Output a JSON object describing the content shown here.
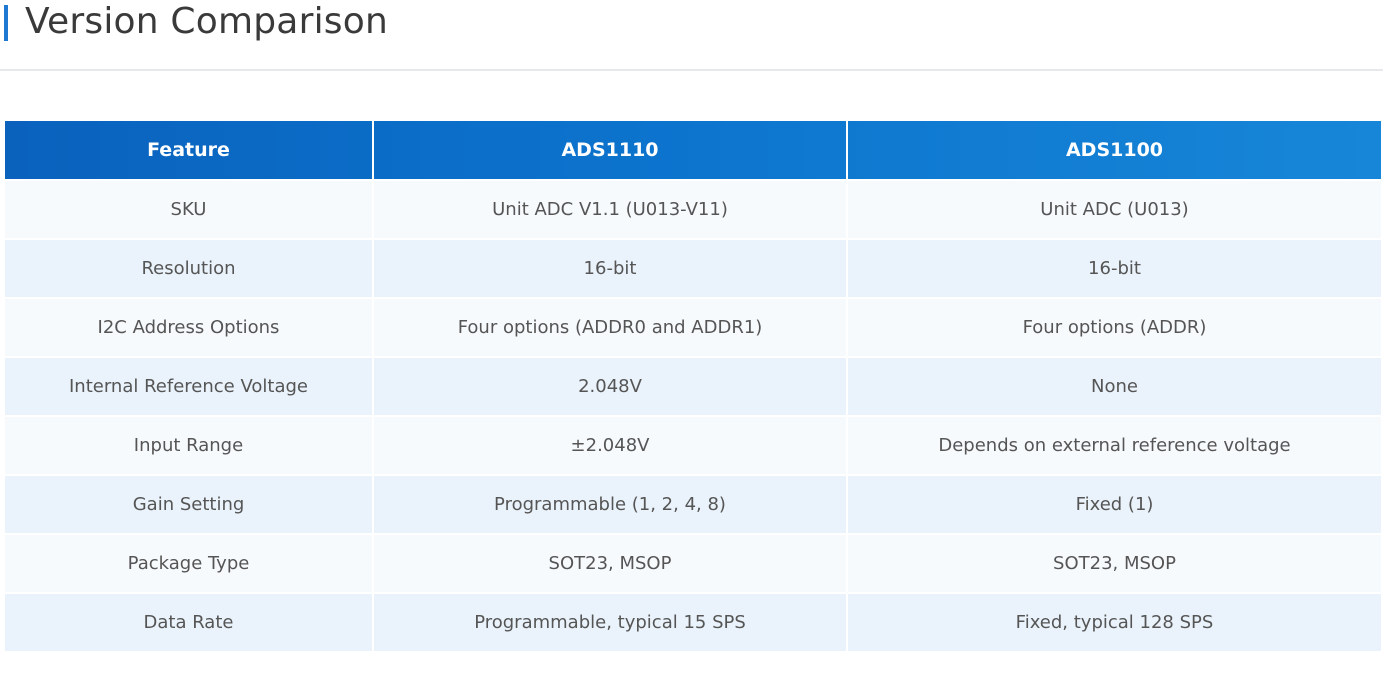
{
  "page": {
    "title": "Version Comparison"
  },
  "table": {
    "headers": [
      "Feature",
      "ADS1110",
      "ADS1100"
    ],
    "rows": [
      [
        "SKU",
        "Unit ADC V1.1 (U013-V11)",
        "Unit ADC (U013)"
      ],
      [
        "Resolution",
        "16-bit",
        "16-bit"
      ],
      [
        "I2C Address Options",
        "Four options (ADDR0 and ADDR1)",
        "Four options (ADDR)"
      ],
      [
        "Internal Reference Voltage",
        "2.048V",
        "None"
      ],
      [
        "Input Range",
        "±2.048V",
        "Depends on external reference voltage"
      ],
      [
        "Gain Setting",
        "Programmable (1, 2, 4, 8)",
        "Fixed (1)"
      ],
      [
        "Package Type",
        "SOT23, MSOP",
        "SOT23, MSOP"
      ],
      [
        "Data Rate",
        "Programmable, typical 15 SPS",
        "Fixed, typical 128 SPS"
      ]
    ]
  },
  "colors": {
    "accent": "#1f78d1",
    "header_start": "#0a62bd",
    "header_end": "#1786d8",
    "row_odd": "#f7fafd",
    "row_even": "#eaf3fb"
  }
}
